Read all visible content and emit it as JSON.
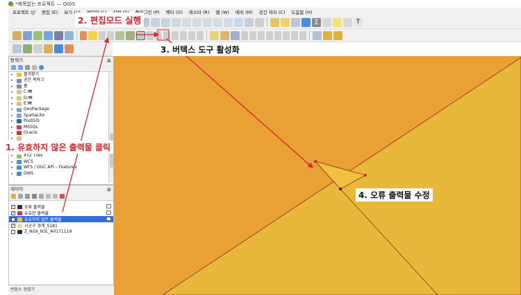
{
  "window": {
    "title": "*제목없는 프로젝트 — QGIS"
  },
  "menu": [
    "프로젝트 (J)",
    "편집 (E)",
    "보기 (V)",
    "레이어 (L)",
    "설정 (S)",
    "플러그인 (P)",
    "벡터 (O)",
    "래스터 (R)",
    "웹 (W)",
    "메쉬 (M)",
    "공간 처리 (C)",
    "도움말 (H)"
  ],
  "browser_panel": {
    "title": "탐색기",
    "items": [
      {
        "label": "즐겨찾기",
        "icon": "star-icon"
      },
      {
        "label": "공간 북마크",
        "icon": "bookmark-icon"
      },
      {
        "label": "홈",
        "icon": "home-folder-icon"
      },
      {
        "label": "C:₩",
        "icon": "drive-icon"
      },
      {
        "label": "D:₩",
        "icon": "drive-icon"
      },
      {
        "label": "E:₩",
        "icon": "drive-icon"
      },
      {
        "label": "GeoPackage",
        "icon": "geopackage-icon"
      },
      {
        "label": "SpatiaLite",
        "icon": "spatialite-icon"
      },
      {
        "label": "PostGIS",
        "icon": "postgis-icon"
      },
      {
        "label": "MSSQL",
        "icon": "mssql-icon"
      },
      {
        "label": "Oracle",
        "icon": "oracle-icon"
      },
      {
        "label": "",
        "icon": "folder-icon"
      },
      {
        "label": "",
        "icon": "folder-icon"
      },
      {
        "label": "Vector Tiles",
        "icon": "vector-tiles-icon"
      },
      {
        "label": "XYZ Tiles",
        "icon": "xyz-tiles-icon"
      },
      {
        "label": "WCS",
        "icon": "wcs-icon"
      },
      {
        "label": "WFS / OGC API – Features",
        "icon": "wfs-icon"
      },
      {
        "label": "OWS",
        "icon": "ows-icon"
      }
    ]
  },
  "layers_panel": {
    "title": "레이어",
    "layers": [
      {
        "label": "오류 출력물",
        "checked": true,
        "swatch": "#333333",
        "selected": false
      },
      {
        "label": "유효한 출력물",
        "checked": true,
        "swatch": "#d9304f",
        "selected": false
      },
      {
        "label": "유효하지 않은 출력물",
        "checked": true,
        "swatch": "#f0c040",
        "selected": true
      },
      {
        "label": "시군구 경계_5181",
        "checked": true,
        "swatch": "#efd9a0",
        "selected": false
      },
      {
        "label": "Z_NGII_N3L_A0171119",
        "checked": false,
        "swatch": "#333333",
        "selected": false
      }
    ]
  },
  "bottom_panel": {
    "title": "변환소 정렬기"
  },
  "annotations": {
    "step1": "1. 유효하지 않은 출력물 클릭",
    "step2": "2. 편집모드 실행",
    "step3": "3. 버텍스 도구 활성화",
    "step4": "4. 오류 출력물 수정"
  },
  "colors": {
    "map_background": "#e9a136",
    "polygon_fill": "#e8b83a",
    "annotation_red": "#d6202a",
    "selection_blue": "#2f6fd6"
  }
}
